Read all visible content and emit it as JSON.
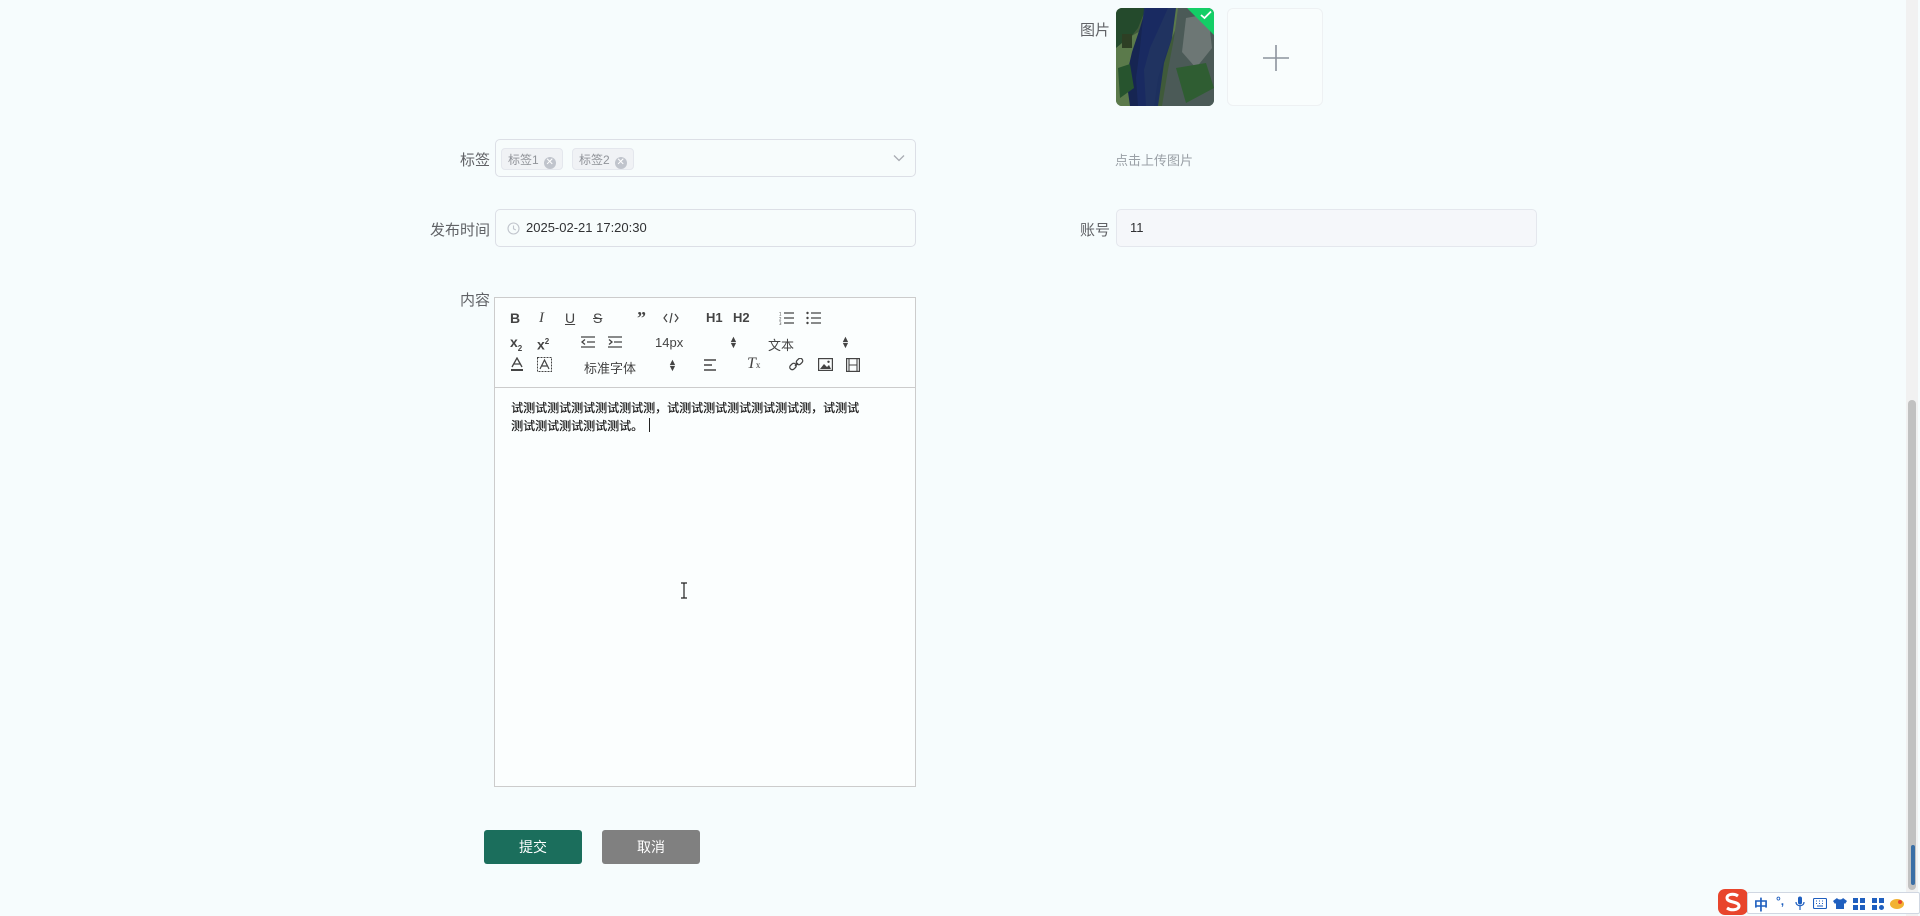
{
  "form": {
    "labels": {
      "image": "图片",
      "tags": "标签",
      "publish_time": "发布时间",
      "account": "账号",
      "content": "内容"
    },
    "upload_hint": "点击上传图片",
    "tags": [
      "标签1",
      "标签2"
    ],
    "publish_time_value": "2025-02-21 17:20:30",
    "account_value": "11"
  },
  "editor": {
    "toolbar": {
      "bold": "B",
      "italic": "I",
      "underline": "U",
      "strike": "S",
      "h1": "H1",
      "h2": "H2",
      "font_size": "14px",
      "header_style": "文本",
      "font_family": "标准字体"
    },
    "content_line1": "试测试测试测试测试测试测，试测试测试测试测试测试测，试测试",
    "content_line2": "测试测试测试测试测试。"
  },
  "buttons": {
    "submit": "提交",
    "cancel": "取消"
  },
  "ime": {
    "lang": "中",
    "punct": "°,"
  },
  "colors": {
    "primary": "#1b6e5c",
    "cancel": "#808080",
    "success": "#13ce66",
    "background": "#f6fcfd"
  }
}
